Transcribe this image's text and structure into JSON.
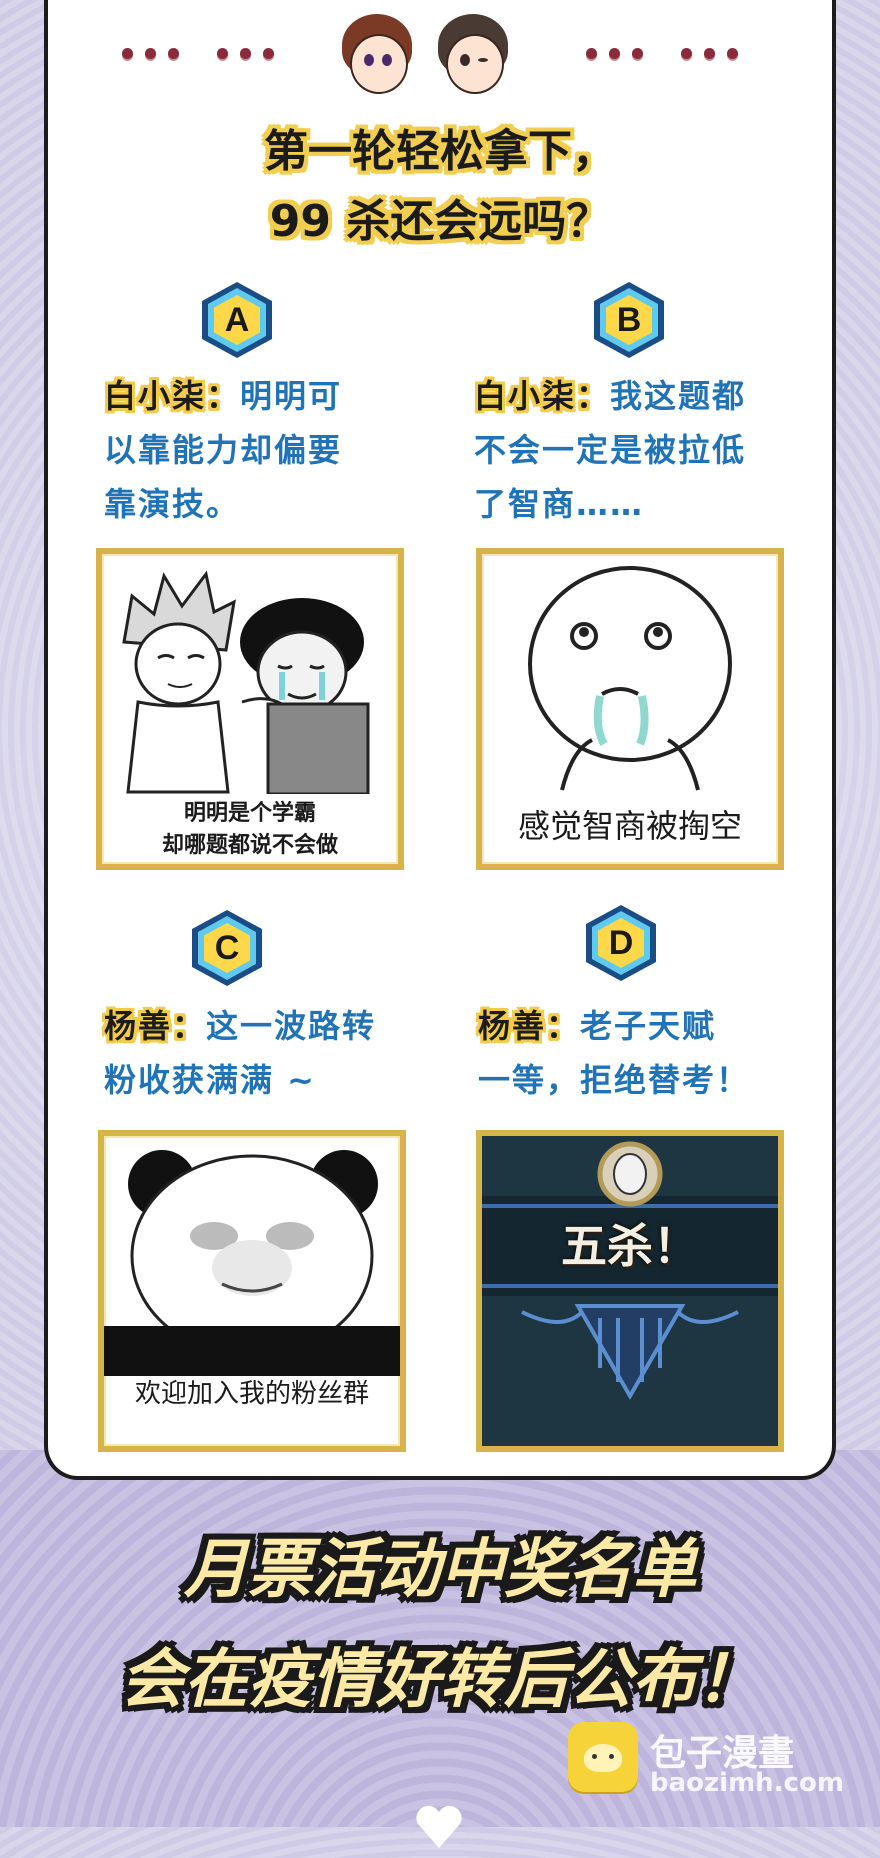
{
  "header": {
    "title_line1": "第一轮轻松拿下，",
    "title_line2": "99 杀还会远吗？"
  },
  "options": [
    {
      "letter": "A",
      "speaker": "白小柒：",
      "text_lines": [
        "明明可",
        "以靠能力却偏要",
        "靠演技。"
      ],
      "meme_caption_lines": [
        "明明是个学霸",
        "却哪题都说不会做"
      ]
    },
    {
      "letter": "B",
      "speaker": "白小柒：",
      "text_lines": [
        "我这题都",
        "不会一定是被拉低",
        "了智商……"
      ],
      "meme_caption_lines": [
        "感觉智商被掏空"
      ]
    },
    {
      "letter": "C",
      "speaker": "杨善：",
      "text_lines": [
        "这一波路转",
        "粉收获满满 ~"
      ],
      "meme_caption_lines": [
        "欢迎加入我的粉丝群"
      ]
    },
    {
      "letter": "D",
      "speaker": "杨善：",
      "text_lines": [
        "老子天赋",
        "一等，拒绝替考！"
      ],
      "meme_caption_lines": [
        "五杀！"
      ]
    }
  ],
  "announcement": {
    "line1": "月票活动中奖名单",
    "line2": "会在疫情好转后公布！"
  },
  "watermark": {
    "name": "包子漫畫",
    "url": "baozimh.com"
  },
  "colors": {
    "accent_yellow": "#f3cb4a",
    "text_blue": "#1f73b6",
    "frame_gold": "#d8b24a",
    "dot_red": "#8a2b3b"
  }
}
